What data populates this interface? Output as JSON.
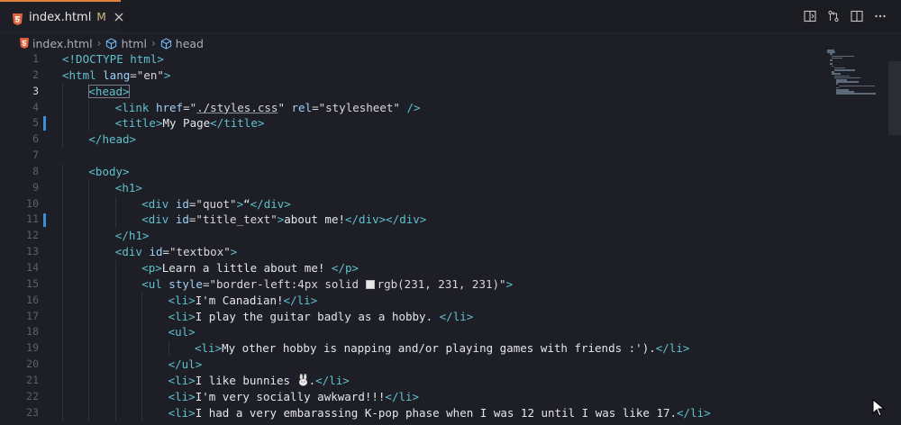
{
  "tab": {
    "label": "index.html",
    "badge": "M",
    "icon": "html5-icon"
  },
  "actions": [
    "open-preview-icon",
    "compare-changes-icon",
    "split-editor-icon",
    "more-actions-icon"
  ],
  "breadcrumb": {
    "items": [
      {
        "label": "index.html",
        "icon": "html5-icon"
      },
      {
        "label": "html",
        "icon": "cube-icon"
      },
      {
        "label": "head",
        "icon": "cube-icon"
      }
    ]
  },
  "editor": {
    "active_line": 3,
    "modified_lines": [
      5,
      11
    ],
    "line_numbers": [
      "1",
      "2",
      "3",
      "4",
      "5",
      "6",
      "7",
      "8",
      "9",
      "10",
      "11",
      "12",
      "13",
      "14",
      "15",
      "16",
      "17",
      "18",
      "19",
      "20",
      "21",
      "22",
      "23"
    ],
    "lines": [
      {
        "indent": 0,
        "tokens": [
          [
            "tag",
            "<!DOCTYPE html>"
          ]
        ]
      },
      {
        "indent": 0,
        "tokens": [
          [
            "tag",
            "<html "
          ],
          [
            "attr",
            "lang"
          ],
          [
            "val",
            "=\"en\""
          ],
          [
            "tag",
            ">"
          ]
        ]
      },
      {
        "indent": 1,
        "tokens": [
          [
            "tag",
            "<head>"
          ]
        ]
      },
      {
        "indent": 2,
        "tokens": [
          [
            "tag",
            "<link "
          ],
          [
            "attr",
            "href"
          ],
          [
            "val",
            "=\""
          ],
          [
            "link",
            "./styles.css"
          ],
          [
            "val",
            "\" "
          ],
          [
            "attr",
            "rel"
          ],
          [
            "val",
            "=\"stylesheet\""
          ],
          [
            "tag",
            " />"
          ]
        ]
      },
      {
        "indent": 2,
        "tokens": [
          [
            "tag",
            "<title>"
          ],
          [
            "text",
            "My Page"
          ],
          [
            "tag",
            "</title>"
          ]
        ]
      },
      {
        "indent": 1,
        "tokens": [
          [
            "tag",
            "</head>"
          ]
        ]
      },
      {
        "indent": 0,
        "tokens": []
      },
      {
        "indent": 1,
        "tokens": [
          [
            "tag",
            "<body>"
          ]
        ]
      },
      {
        "indent": 2,
        "tokens": [
          [
            "tag",
            "<h1>"
          ]
        ]
      },
      {
        "indent": 3,
        "tokens": [
          [
            "tag",
            "<div "
          ],
          [
            "attr",
            "id"
          ],
          [
            "val",
            "=\"quot\""
          ],
          [
            "tag",
            ">"
          ],
          [
            "text",
            "“"
          ],
          [
            "tag",
            "</div>"
          ]
        ]
      },
      {
        "indent": 3,
        "tokens": [
          [
            "tag",
            "<div "
          ],
          [
            "attr",
            "id"
          ],
          [
            "val",
            "=\"title_text\""
          ],
          [
            "tag",
            ">"
          ],
          [
            "text",
            "about me!"
          ],
          [
            "tag",
            "</div></div>"
          ]
        ]
      },
      {
        "indent": 2,
        "tokens": [
          [
            "tag",
            "</h1>"
          ]
        ]
      },
      {
        "indent": 2,
        "tokens": [
          [
            "tag",
            "<div "
          ],
          [
            "attr",
            "id"
          ],
          [
            "val",
            "=\"textbox\""
          ],
          [
            "tag",
            ">"
          ]
        ]
      },
      {
        "indent": 3,
        "tokens": [
          [
            "tag",
            "<p>"
          ],
          [
            "text",
            "Learn a little about me! "
          ],
          [
            "tag",
            "</p>"
          ]
        ]
      },
      {
        "indent": 3,
        "tokens": [
          [
            "tag",
            "<ul "
          ],
          [
            "attr",
            "style"
          ],
          [
            "val",
            "=\"border-left:4px solid "
          ],
          [
            "swatch",
            ""
          ],
          [
            "val",
            "rgb(231, 231, 231)\""
          ],
          [
            "tag",
            ">"
          ]
        ]
      },
      {
        "indent": 4,
        "tokens": [
          [
            "tag",
            "<li>"
          ],
          [
            "text",
            "I'm Canadian!"
          ],
          [
            "tag",
            "</li>"
          ]
        ]
      },
      {
        "indent": 4,
        "tokens": [
          [
            "tag",
            "<li>"
          ],
          [
            "text",
            "I play the guitar badly as a hobby. "
          ],
          [
            "tag",
            "</li>"
          ]
        ]
      },
      {
        "indent": 4,
        "tokens": [
          [
            "tag",
            "<ul>"
          ]
        ]
      },
      {
        "indent": 5,
        "tokens": [
          [
            "tag",
            "<li>"
          ],
          [
            "text",
            "My other hobby is napping and/or playing games with friends :')."
          ],
          [
            "tag",
            "</li>"
          ]
        ]
      },
      {
        "indent": 4,
        "tokens": [
          [
            "tag",
            "</ul>"
          ]
        ]
      },
      {
        "indent": 4,
        "tokens": [
          [
            "tag",
            "<li>"
          ],
          [
            "text",
            "I like bunnies "
          ],
          [
            "bunny",
            ""
          ],
          [
            "text",
            "."
          ],
          [
            "tag",
            "</li>"
          ]
        ]
      },
      {
        "indent": 4,
        "tokens": [
          [
            "tag",
            "<li>"
          ],
          [
            "text",
            "I'm very socially awkward!!!"
          ],
          [
            "tag",
            "</li>"
          ]
        ]
      },
      {
        "indent": 4,
        "tokens": [
          [
            "tag",
            "<li>"
          ],
          [
            "text",
            "I had a very embarassing K-pop phase when I was 12 until I was like 17."
          ],
          [
            "tag",
            "</li>"
          ]
        ]
      }
    ]
  }
}
